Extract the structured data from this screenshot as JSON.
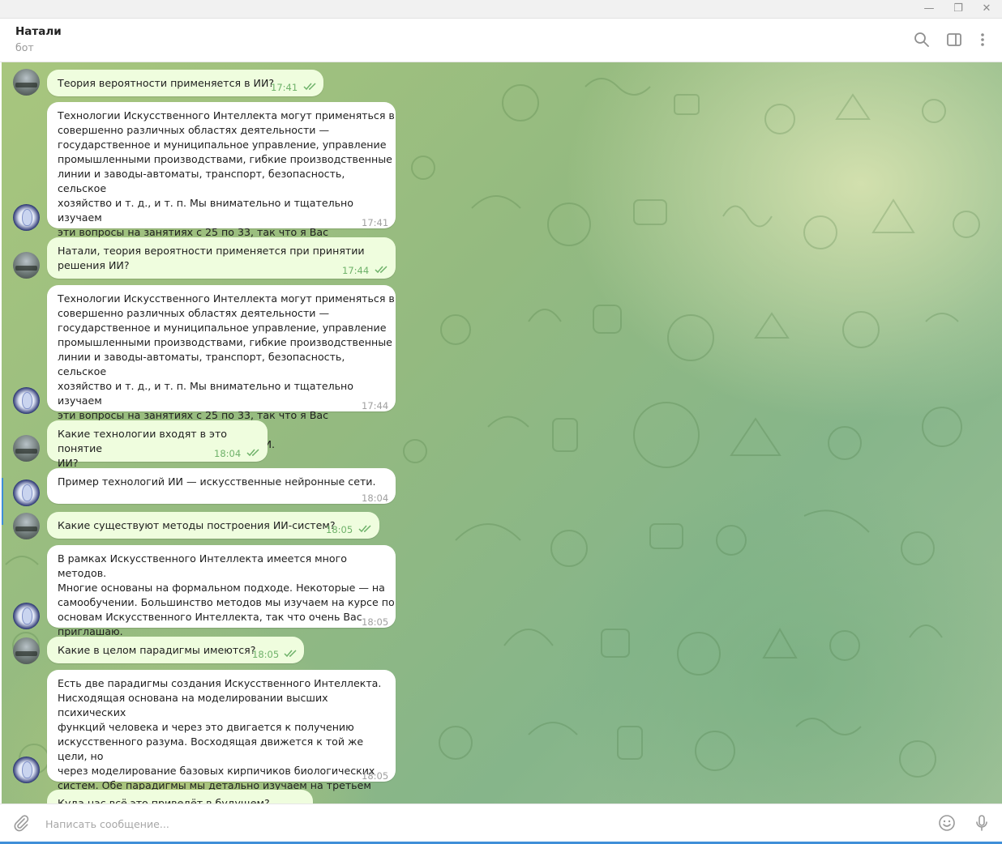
{
  "window": {
    "minimize_glyph": "—",
    "restore_glyph": "❐",
    "close_glyph": "✕"
  },
  "header": {
    "title": "Натали",
    "status": "бот",
    "icons": [
      "search-icon",
      "sidebar-toggle-icon",
      "more-vertical-icon"
    ]
  },
  "messages": [
    {
      "side": "out",
      "text": "Теория вероятности применяется в ИИ?",
      "time": "17:41",
      "read": true
    },
    {
      "side": "in",
      "text": "Технологии Искусственного Интеллекта могут применяться в\nсовершенно различных областях деятельности —\nгосударственное и муниципальное управление, управление\nпромышленными производствами, гибкие производственные\nлинии и заводы-автоматы, транспорт, безопасность, сельское\nхозяйство и т. д., и т. п. Мы внимательно и тщательно изучаем\nэти вопросы на занятиях с 25 по 33, так что я Вас обязательно\nприглашаю на наш курс по основам ИИ.",
      "time": "17:41"
    },
    {
      "side": "out",
      "text": "Натали, теория вероятности применяется при принятии\nрешения ИИ?",
      "time": "17:44",
      "read": true
    },
    {
      "side": "in",
      "text": "Технологии Искусственного Интеллекта могут применяться в\nсовершенно различных областях деятельности —\nгосударственное и муниципальное управление, управление\nпромышленными производствами, гибкие производственные\nлинии и заводы-автоматы, транспорт, безопасность, сельское\nхозяйство и т. д., и т. п. Мы внимательно и тщательно изучаем\nэти вопросы на занятиях с 25 по 33, так что я Вас обязательно\nприглашаю на наш курс по основам ИИ.",
      "time": "17:44"
    },
    {
      "side": "out",
      "text": "Какие технологии входят в это понятие\n ИИ?",
      "time": "18:04",
      "read": true
    },
    {
      "side": "in",
      "text": "Пример технологий ИИ — искусственные нейронные сети.",
      "time": "18:04"
    },
    {
      "side": "out",
      "text": "Какие существуют методы построения ИИ-систем?",
      "time": "18:05",
      "read": true
    },
    {
      "side": "in",
      "text": "В рамках Искусственного Интеллекта имеется много методов.\nМногие основаны на формальном подходе. Некоторые — на\nсамообучении. Большинство методов мы изучаем на курсе по\nосновам Искусственного Интеллекта, так что очень Вас\nприглашаю.",
      "time": "18:05"
    },
    {
      "side": "out",
      "text": "Какие в целом парадигмы имеются?",
      "time": "18:05",
      "read": true
    },
    {
      "side": "in",
      "text": "Есть две парадигмы создания Искусственного Интеллекта.\nНисходящая основана на моделировании высших психических\nфункций человека и через это двигается к получению\nискусственного разума. Восходящая движется к той же цели, но\nчерез моделирование базовых кирпичиков биологических\nсистем. Обе парадигмы мы детально изучаем на третьем\nзанятии курса. Так что приглашаю.",
      "time": "18:05"
    },
    {
      "side": "out",
      "text": "Куда нас всё это приведёт в будущем?",
      "time": "",
      "read": false
    }
  ],
  "compose": {
    "placeholder": "Написать сообщение...",
    "value": "",
    "icons": [
      "attach-icon",
      "emoji-icon",
      "microphone-icon"
    ]
  },
  "colors": {
    "outgoing_bubble": "#effdde",
    "incoming_bubble": "#ffffff",
    "outgoing_time": "#6fb26a",
    "accent": "#3f8fd8"
  }
}
